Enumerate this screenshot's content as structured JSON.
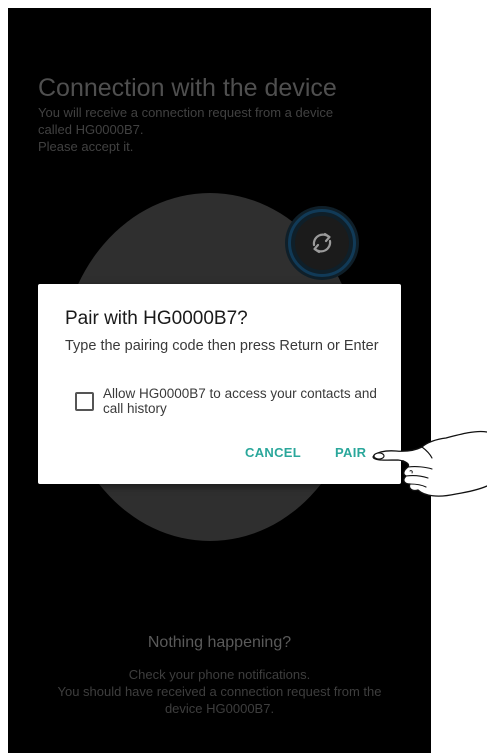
{
  "screen": {
    "title": "Connection with the device",
    "description_lines": [
      "You will receive a connection request from a device",
      "called HG0000B7.",
      "Please accept it."
    ],
    "sync_icon": "sync-icon"
  },
  "footer": {
    "title": "Nothing happening?",
    "description_lines": [
      "Check your phone notifications.",
      "You should have received a connection request from the",
      "device HG0000B7."
    ]
  },
  "dialog": {
    "title": "Pair with HG0000B7?",
    "message": "Type the pairing code then press Return or Enter",
    "checkbox_label": "Allow HG0000B7 to access your contacts and call history",
    "checkbox_checked": false,
    "cancel_label": "CANCEL",
    "pair_label": "PAIR"
  },
  "colors": {
    "accent": "#2aa79b",
    "background": "#000000",
    "dialog_background": "#ffffff",
    "ring": "#113a57"
  },
  "icons": {
    "hand": "pointing-hand-icon",
    "checkbox": "checkbox-icon"
  }
}
